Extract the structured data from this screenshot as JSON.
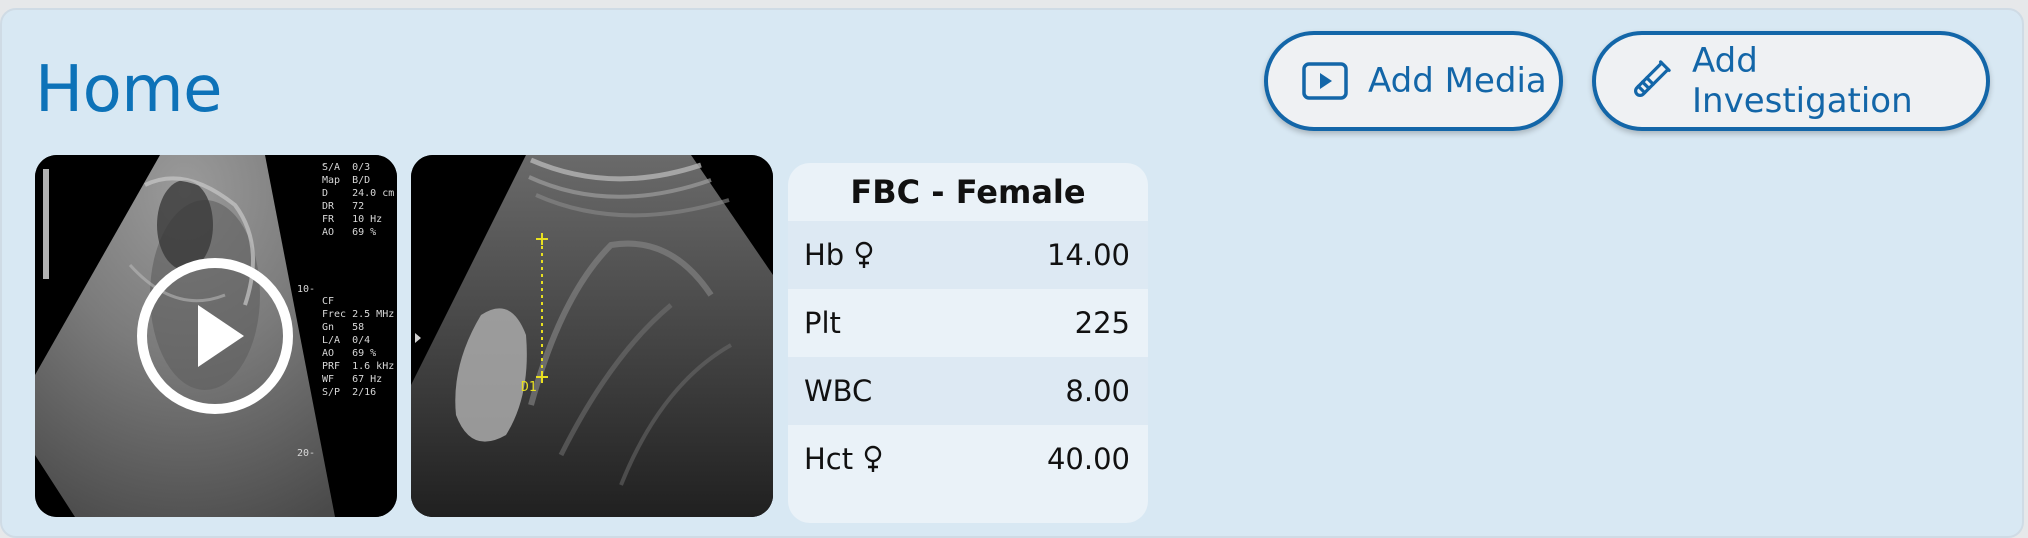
{
  "header": {
    "title": "Home"
  },
  "actions": {
    "add_media_label": "Add Media",
    "add_investigation_label": "Add Investigation"
  },
  "media": {
    "items": [
      {
        "type": "video",
        "overlay_top": "S/A  0/3\nMap  B/D\nD    24.0 cm\nDR   72\nFR   10 Hz\nAO   69 %",
        "overlay_bottom": "CF\nFrec 2.5 MHz\nGn   58\nL/A  0/4\nAO   69 %\nPRF  1.6 kHz\nWF   67 Hz\nS/P  2/16",
        "depth_10": "10-",
        "depth_20": "20-"
      },
      {
        "type": "image",
        "marker_label": "D1"
      }
    ]
  },
  "investigation": {
    "title": "FBC - Female",
    "rows": [
      {
        "name": "Hb",
        "sex_specific": true,
        "value": "14.00"
      },
      {
        "name": "Plt",
        "sex_specific": false,
        "value": "225"
      },
      {
        "name": "WBC",
        "sex_specific": false,
        "value": "8.00"
      },
      {
        "name": "Hct",
        "sex_specific": true,
        "value": "40.00"
      }
    ]
  },
  "colors": {
    "accent": "#1366a8",
    "title": "#0d72b8",
    "panel": "#d8e8f3",
    "card": "#eaf2f8",
    "marker": "#e8e020"
  },
  "icons": {
    "add_media": "play-square-icon",
    "add_investigation": "test-tube-icon",
    "video": "play-circle-icon",
    "sex": "female-sign-icon"
  }
}
